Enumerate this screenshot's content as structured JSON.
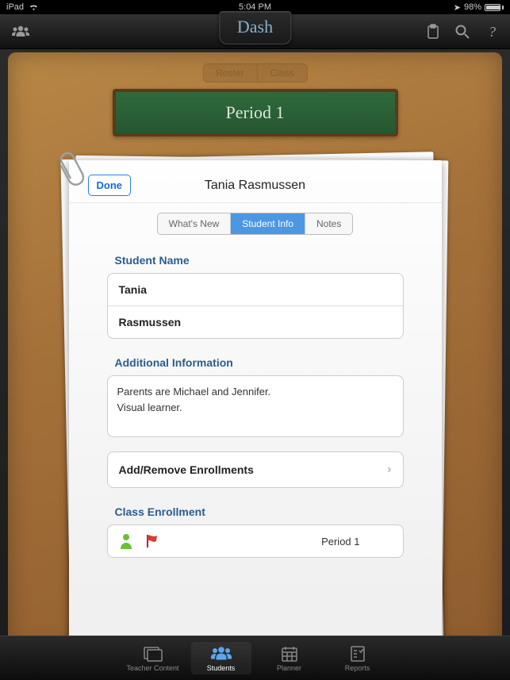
{
  "status": {
    "device": "iPad",
    "time": "5:04 PM",
    "battery_pct": "98%"
  },
  "app": {
    "title": "Dash"
  },
  "background": {
    "segments": [
      "Roster",
      "Class"
    ],
    "chalkboard": "Period 1"
  },
  "sheet": {
    "done": "Done",
    "title": "Tania Rasmussen",
    "tabs": [
      {
        "label": "What's New",
        "active": false
      },
      {
        "label": "Student Info",
        "active": true
      },
      {
        "label": "Notes",
        "active": false
      }
    ],
    "student_name_label": "Student Name",
    "first_name": "Tania",
    "last_name": "Rasmussen",
    "additional_label": "Additional Information",
    "additional_text": "Parents are Michael and Jennifer.\nVisual learner.",
    "enroll_link": "Add/Remove Enrollments",
    "class_enroll_label": "Class Enrollment",
    "enroll_period": "Period 1"
  },
  "tabbar": [
    {
      "label": "Teacher Content",
      "active": false
    },
    {
      "label": "Students",
      "active": true
    },
    {
      "label": "Planner",
      "active": false
    },
    {
      "label": "Reports",
      "active": false
    }
  ]
}
